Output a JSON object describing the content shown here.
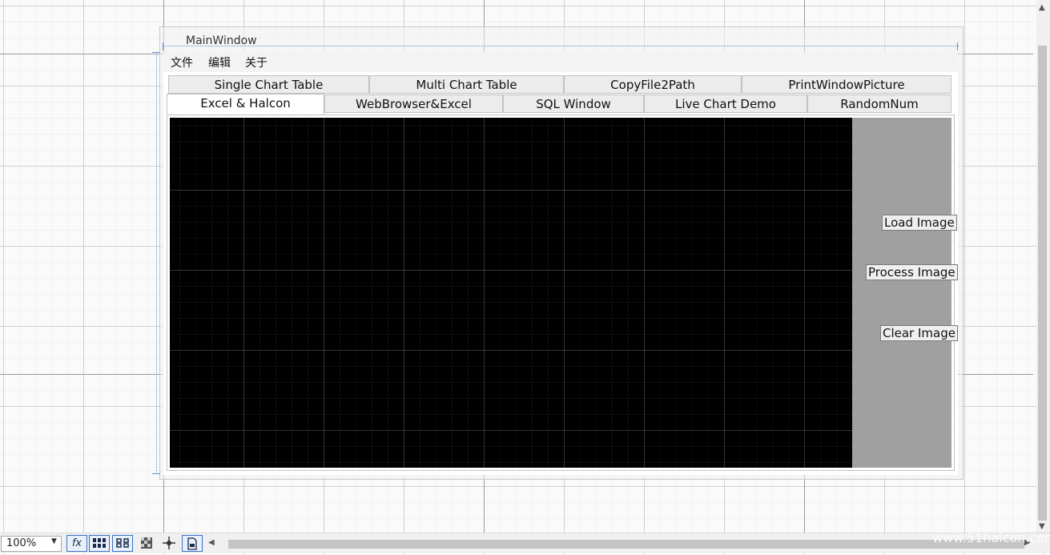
{
  "window": {
    "title": "MainWindow"
  },
  "menu": [
    "文件",
    "编辑",
    "关于"
  ],
  "tabs_row1": [
    "Single Chart Table",
    "Multi Chart Table",
    "CopyFile2Path",
    "PrintWindowPicture"
  ],
  "tabs_row2": [
    "Excel & Halcon",
    "WebBrowser&Excel",
    "SQL Window",
    "Live Chart Demo",
    "RandomNum"
  ],
  "active_tab": "Excel & Halcon",
  "buttons": {
    "load": "Load Image",
    "process": "Process Image",
    "clear": "Clear Image"
  },
  "statusbar": {
    "zoom": "100%",
    "fx": "fx"
  },
  "icons": [
    "fx-icon",
    "grid-layout-icon",
    "snap-grid-icon",
    "checker-icon",
    "crosshair-icon",
    "document-icon"
  ],
  "watermark": "www.51halcon.com",
  "colors": {
    "image_view": "#000000",
    "side_panel": "#a0a0a0",
    "selection": "#6b8fd6"
  }
}
